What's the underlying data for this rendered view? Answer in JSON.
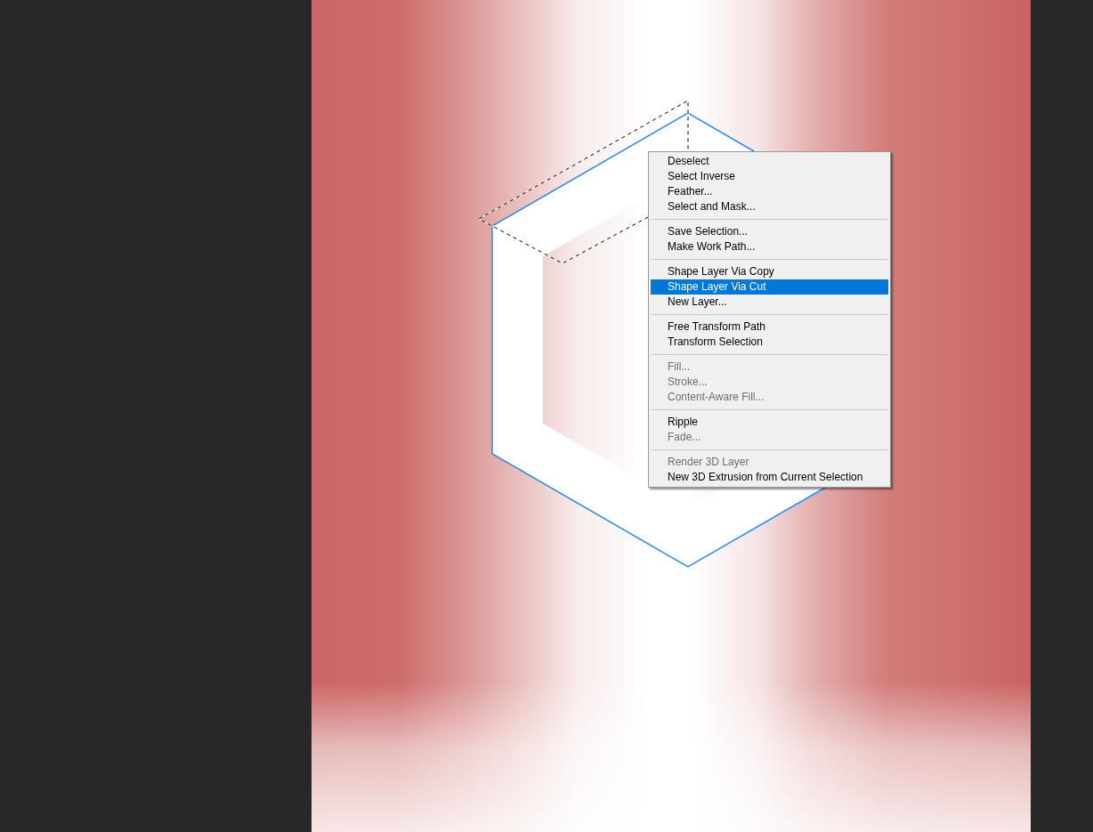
{
  "context_menu": {
    "sections": [
      {
        "items": [
          {
            "label": "Deselect",
            "disabled": false,
            "selected": false
          },
          {
            "label": "Select Inverse",
            "disabled": false,
            "selected": false
          },
          {
            "label": "Feather...",
            "disabled": false,
            "selected": false
          },
          {
            "label": "Select and Mask...",
            "disabled": false,
            "selected": false
          }
        ]
      },
      {
        "items": [
          {
            "label": "Save Selection...",
            "disabled": false,
            "selected": false
          },
          {
            "label": "Make Work Path...",
            "disabled": false,
            "selected": false
          }
        ]
      },
      {
        "items": [
          {
            "label": "Shape Layer Via Copy",
            "disabled": false,
            "selected": false
          },
          {
            "label": "Shape Layer Via Cut",
            "disabled": false,
            "selected": true
          },
          {
            "label": "New Layer...",
            "disabled": false,
            "selected": false
          }
        ]
      },
      {
        "items": [
          {
            "label": "Free Transform Path",
            "disabled": false,
            "selected": false
          },
          {
            "label": "Transform Selection",
            "disabled": false,
            "selected": false
          }
        ]
      },
      {
        "items": [
          {
            "label": "Fill...",
            "disabled": true,
            "selected": false
          },
          {
            "label": "Stroke...",
            "disabled": true,
            "selected": false
          },
          {
            "label": "Content-Aware Fill...",
            "disabled": true,
            "selected": false
          }
        ]
      },
      {
        "items": [
          {
            "label": "Ripple",
            "disabled": false,
            "selected": false
          },
          {
            "label": "Fade...",
            "disabled": true,
            "selected": false
          }
        ]
      },
      {
        "items": [
          {
            "label": "Render 3D Layer",
            "disabled": true,
            "selected": false
          },
          {
            "label": "New 3D Extrusion from Current Selection",
            "disabled": false,
            "selected": false
          }
        ]
      }
    ]
  }
}
